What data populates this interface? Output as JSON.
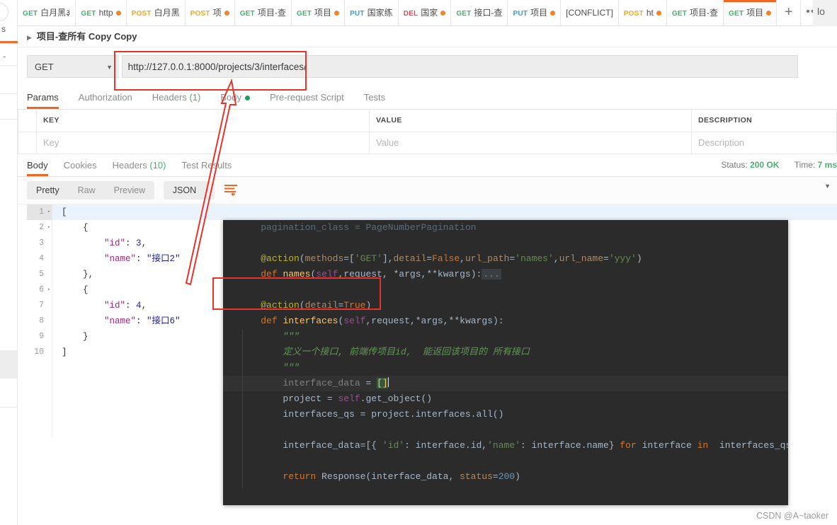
{
  "window": {
    "right_fragment": "lo"
  },
  "tabstrip": {
    "tabs": [
      {
        "method": "GET",
        "method_class": "m-get",
        "label": "白月黑३",
        "dot": false
      },
      {
        "method": "GET",
        "method_class": "m-get",
        "label": "http",
        "dot": true
      },
      {
        "method": "POST",
        "method_class": "m-post",
        "label": "白月黑",
        "dot": false
      },
      {
        "method": "POST",
        "method_class": "m-post",
        "label": "项",
        "dot": true
      },
      {
        "method": "GET",
        "method_class": "m-get",
        "label": "项目-查",
        "dot": false
      },
      {
        "method": "GET",
        "method_class": "m-get",
        "label": "项目",
        "dot": true
      },
      {
        "method": "PUT",
        "method_class": "m-put",
        "label": "国家练",
        "dot": false
      },
      {
        "method": "DEL",
        "method_class": "m-del",
        "label": "国家",
        "dot": true
      },
      {
        "method": "GET",
        "method_class": "m-get",
        "label": "接口-查",
        "dot": false
      },
      {
        "method": "PUT",
        "method_class": "m-put",
        "label": "项目",
        "dot": true
      },
      {
        "method": "",
        "method_class": "",
        "label": "[CONFLICT]",
        "dot": false
      },
      {
        "method": "POST",
        "method_class": "m-post",
        "label": "ht",
        "dot": true
      },
      {
        "method": "GET",
        "method_class": "m-get",
        "label": "项目-查",
        "dot": false
      },
      {
        "method": "GET",
        "method_class": "m-get",
        "label": "项目",
        "dot": true,
        "active": true
      }
    ],
    "new_tab_label": "+",
    "more_label": "•••"
  },
  "breadcrumb": {
    "caret": "▶",
    "title": "项目-查所有 Copy Copy"
  },
  "request": {
    "method": "GET",
    "method_chevron": "▼",
    "url": "http://127.0.0.1:8000/projects/3/interfaces/",
    "tabs": [
      {
        "label": "Params",
        "selected": true
      },
      {
        "label": "Authorization",
        "selected": false
      },
      {
        "label": "Headers",
        "count": "(1)",
        "selected": false
      },
      {
        "label": "Body",
        "dot": true,
        "selected": false
      },
      {
        "label": "Pre-request Script",
        "selected": false
      },
      {
        "label": "Tests",
        "selected": false
      }
    ],
    "params_table": {
      "headers": [
        "KEY",
        "VALUE",
        "DESCRIPTION"
      ],
      "placeholder_row": [
        "Key",
        "Value",
        "Description"
      ]
    }
  },
  "response": {
    "tabs": [
      {
        "label": "Body",
        "selected": true
      },
      {
        "label": "Cookies",
        "selected": false
      },
      {
        "label": "Headers",
        "count": "(10)",
        "selected": false
      },
      {
        "label": "Test Results",
        "selected": false
      }
    ],
    "status_label": "Status:",
    "status_value": "200 OK",
    "time_label": "Time:",
    "time_value": "7 ms",
    "viewer": {
      "modes": [
        "Pretty",
        "Raw",
        "Preview"
      ],
      "selected_mode": "Pretty",
      "format": "JSON",
      "format_chevron": "▼",
      "wrap_icon": "wrap-lines-icon"
    },
    "body_lines": [
      {
        "n": "1",
        "fold": "▾",
        "hl": true,
        "html": "<span class=\"jpun\">[</span>"
      },
      {
        "n": "2",
        "fold": "▾",
        "html": "    <span class=\"jpun\">{</span>"
      },
      {
        "n": "3",
        "html": "        <span class=\"jkey\">\"id\"</span><span class=\"jpun\">: </span><span class=\"jnum\">3</span><span class=\"jpun\">,</span>"
      },
      {
        "n": "4",
        "html": "        <span class=\"jkey\">\"name\"</span><span class=\"jpun\">: </span><span class=\"jstr\">\"接口2\"</span>"
      },
      {
        "n": "5",
        "html": "    <span class=\"jpun\">},</span>"
      },
      {
        "n": "6",
        "fold": "▾",
        "html": "    <span class=\"jpun\">{</span>"
      },
      {
        "n": "7",
        "html": "        <span class=\"jkey\">\"id\"</span><span class=\"jpun\">: </span><span class=\"jnum\">4</span><span class=\"jpun\">,</span>"
      },
      {
        "n": "8",
        "html": "        <span class=\"jkey\">\"name\"</span><span class=\"jpun\">: </span><span class=\"jstr\">\"接口6\"</span>"
      },
      {
        "n": "9",
        "html": "    <span class=\"jpun\">}</span>"
      },
      {
        "n": "10",
        "html": "<span class=\"jpun\">]</span>"
      }
    ]
  },
  "code_overlay": {
    "lines": [
      {
        "cls": "toprow",
        "html": "    pagination_class = PageNumberPagination"
      },
      {
        "html": ""
      },
      {
        "html": "    <span class=\"k-dec\">@action</span><span class=\"k-pl\">(</span><span class=\"k-par\">methods</span><span class=\"k-pl\">=[</span><span class=\"k-str\">'GET'</span><span class=\"k-pl\">],</span><span class=\"k-par\">detail</span><span class=\"k-pl\">=</span><span class=\"k-kw\">False</span><span class=\"k-pl\">,</span><span class=\"k-par\">url_path</span><span class=\"k-pl\">=</span><span class=\"k-str\">'names'</span><span class=\"k-pl\">,</span><span class=\"k-par\">url_name</span><span class=\"k-pl\">=</span><span class=\"k-str\">'yyy'</span><span class=\"k-pl\">)</span>"
      },
      {
        "html": "    <span class=\"k-kw\">def</span> <span class=\"k-fn\">names</span><span class=\"k-pl\">(</span><span class=\"k-self\">self</span><span class=\"k-pl\">,</span><span class=\"k-pl\">request, *args</span><span class=\"k-pl\">,</span><span class=\"k-pl\">**kwargs):</span><span class=\"ell\">...</span>"
      },
      {
        "html": ""
      },
      {
        "html": "    <span class=\"k-dec\">@action</span><span class=\"k-pl\">(</span><span class=\"k-par\">detail</span><span class=\"k-pl\">=</span><span class=\"k-kw\">True</span><span class=\"k-pl\">)</span>"
      },
      {
        "html": "    <span class=\"k-kw\">def</span> <span class=\"k-fn\">interfaces</span><span class=\"k-pl\">(</span><span class=\"k-self\">self</span><span class=\"k-pl\">,</span><span class=\"k-pl\">request</span><span class=\"k-pl\">,</span><span class=\"k-pl\">*args</span><span class=\"k-pl\">,</span><span class=\"k-pl\">**kwargs):</span>"
      },
      {
        "html": "        <span class=\"k-cm\">\"\"\"</span>"
      },
      {
        "html": "        <span class=\"k-cm\">定义一个接口, 前端传项目id,  能返回该项目的 所有接口</span>"
      },
      {
        "html": "        <span class=\"k-cm\">\"\"\"</span>"
      },
      {
        "hl": true,
        "html": "        <span class=\"k-grey\">interface_data</span> <span class=\"k-pl\">= </span><span class=\"sel-yel\">[]</span><span id=\"caret\"></span>"
      },
      {
        "html": "        <span class=\"k-pl\">project = </span><span class=\"k-self\">self</span><span class=\"k-pl\">.get_object()</span>"
      },
      {
        "html": "        <span class=\"k-pl\">interfaces_qs = project.interfaces.all()</span>"
      },
      {
        "html": ""
      },
      {
        "html": "        <span class=\"k-pl\">interface_data=[{ </span><span class=\"k-str\">'id'</span><span class=\"k-pl\">: interface.id</span><span class=\"k-pl\">,</span><span class=\"k-str\">'name'</span><span class=\"k-pl\">: interface.name} </span><span class=\"k-kw\">for</span><span class=\"k-pl\"> interface </span><span class=\"k-kw\">in</span><span class=\"k-pl\">  interfaces_qs]</span>"
      },
      {
        "html": ""
      },
      {
        "html": "        <span class=\"k-kw\">return</span><span class=\"k-pl\"> Response(interface_data, </span><span class=\"k-par\">status</span><span class=\"k-pl\">=</span><span class=\"k-num\">200</span><span class=\"k-pl\">)</span>"
      }
    ]
  },
  "annotations": {
    "url_box": "red-highlight-box-url",
    "action_box": "red-highlight-box-action",
    "arrow": "red-arrow-pointing-to-url"
  },
  "watermark": "CSDN @A~taoker",
  "colors": {
    "accent": "#f26522",
    "get": "#4caf72",
    "post": "#f5a623",
    "put": "#3a9bdc",
    "delete": "#e04b4b",
    "success": "#4caf72",
    "annotation": "#e8322a",
    "editor_bg": "#2b2b2b"
  }
}
